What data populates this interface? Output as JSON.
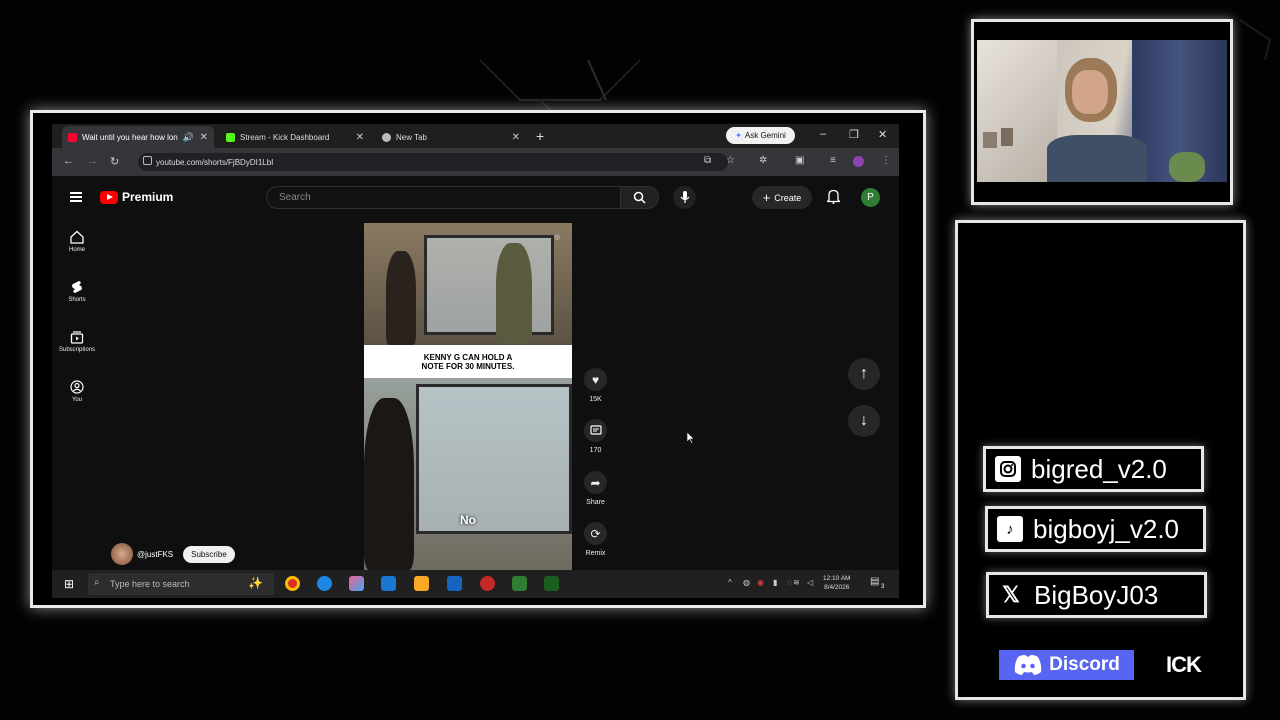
{
  "browser": {
    "tabs": [
      {
        "label": "Wait until you hear how lon",
        "active": true,
        "favicon_color": "#ff0033"
      },
      {
        "label": "Stream - Kick Dashboard",
        "active": false,
        "favicon_color": "#53fc18"
      },
      {
        "label": "New Tab",
        "active": false,
        "favicon_color": "#bbbbbb"
      }
    ],
    "ask_gemini": "Ask Gemini",
    "url": "youtube.com/shorts/FjBDyDI1LbI"
  },
  "youtube": {
    "brand": "Premium",
    "search_placeholder": "Search",
    "create_label": "Create",
    "avatar_letter": "P",
    "guide": [
      {
        "label": "Home",
        "icon": "home-icon"
      },
      {
        "label": "Shorts",
        "icon": "shorts-icon"
      },
      {
        "label": "Subscriptions",
        "icon": "subscriptions-icon"
      },
      {
        "label": "You",
        "icon": "you-icon"
      }
    ],
    "video": {
      "caption": "KENNY G CAN HOLD A\nNOTE FOR 30 MINUTES.",
      "subtitle": "No"
    },
    "actions": {
      "likes": "15K",
      "comments": "170",
      "share": "Share",
      "remix": "Remix"
    },
    "channel": {
      "handle": "@justFKS",
      "subscribe": "Subscribe"
    }
  },
  "taskbar": {
    "search_placeholder": "Type here to search",
    "time": "12:10 AM",
    "date": "8/4/2026",
    "badge": "3"
  },
  "socials": [
    {
      "platform": "instagram",
      "icon": "instagram-icon",
      "handle": "bigred_v2.0"
    },
    {
      "platform": "tiktok",
      "icon": "tiktok-icon",
      "handle": "bigboyj_v2.0"
    },
    {
      "platform": "x",
      "icon": "x-icon",
      "handle": "BigBoyJ03"
    }
  ],
  "discord_label": "Discord",
  "kick_label": "ICK"
}
